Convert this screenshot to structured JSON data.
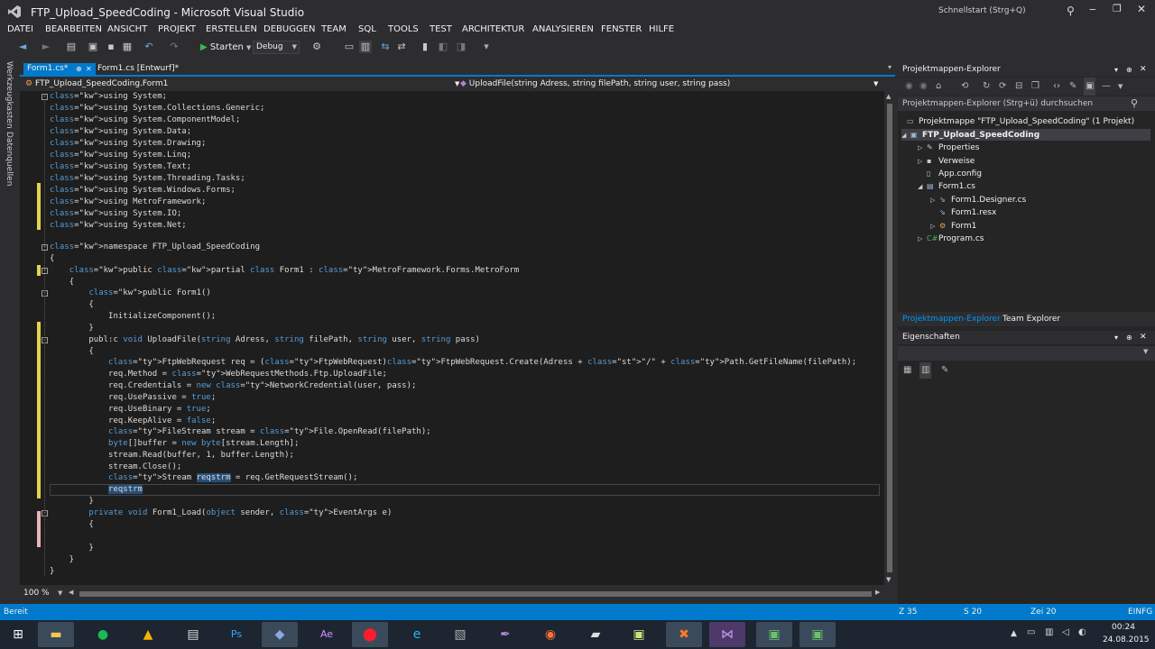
{
  "window": {
    "title": "FTP_Upload_SpeedCoding - Microsoft Visual Studio",
    "quick_launch": "Schnellstart (Strg+Q)"
  },
  "menu": [
    "DATEI",
    "BEARBEITEN",
    "ANSICHT",
    "PROJEKT",
    "ERSTELLEN",
    "DEBUGGEN",
    "TEAM",
    "SQL",
    "TOOLS",
    "TEST",
    "ARCHITEKTUR",
    "ANALYSIEREN",
    "FENSTER",
    "HILFE"
  ],
  "toolbar": {
    "start_label": "Starten",
    "config_value": "Debug"
  },
  "left_strip": {
    "toolbox": "Werkzeugkasten",
    "datasources": "Datenquellen"
  },
  "tabs": {
    "active": "Form1.cs*",
    "inactive": "Form1.cs [Entwurf]*"
  },
  "nav": {
    "class_combo": "FTP_Upload_SpeedCoding.Form1",
    "member_combo": "UploadFile(string Adress, string filePath, string user, string pass)"
  },
  "code": [
    "using System;",
    "using System.Collections.Generic;",
    "using System.ComponentModel;",
    "using System.Data;",
    "using System.Drawing;",
    "using System.Linq;",
    "using System.Text;",
    "using System.Threading.Tasks;",
    "using System.Windows.Forms;",
    "using MetroFramework;",
    "using System.IO;",
    "using System.Net;",
    "",
    "namespace FTP_Upload_SpeedCoding",
    "{",
    "    public partial class Form1 : MetroFramework.Forms.MetroForm",
    "    {",
    "        public Form1()",
    "        {",
    "            InitializeComponent();",
    "        }",
    "        publ:c void UploadFile(string Adress, string filePath, string user, string pass)",
    "        {",
    "            FtpWebRequest req = (FtpWebRequest)FtpWebRequest.Create(Adress + \"/\" + Path.GetFileName(filePath);",
    "            req.Method = WebRequestMethods.Ftp.UploadFile;",
    "            req.Credentials = new NetworkCredential(user, pass);",
    "            req.UsePassive = true;",
    "            req.UseBinary = true;",
    "            req.KeepAlive = false;",
    "            FileStream stream = File.OpenRead(filePath);",
    "            byte[]buffer = new byte[stream.Length];",
    "            stream.Read(buffer, 1, buffer.Length);",
    "            stream.Close();",
    "            Stream reqstrm = req.GetRequestStream();",
    "            reqstrm",
    "        }",
    "        private void Form1_Load(object sender, EventArgs e)",
    "        {",
    "",
    "        }",
    "    }",
    "}"
  ],
  "zoom": "100 %",
  "solution_explorer": {
    "title": "Projektmappen-Explorer",
    "search_placeholder": "Projektmappen-Explorer (Strg+ü) durchsuchen",
    "items": [
      {
        "label": "Projektmappe \"FTP_Upload_SpeedCoding\" (1 Projekt)",
        "icon": "solution-icon",
        "level": 0,
        "arrow": ""
      },
      {
        "label": "FTP_Upload_SpeedCoding",
        "icon": "csharp-project-icon",
        "level": 0,
        "arrow": "◢"
      },
      {
        "label": "Properties",
        "icon": "wrench-icon",
        "level": 1,
        "arrow": "▷"
      },
      {
        "label": "Verweise",
        "icon": "references-icon",
        "level": 1,
        "arrow": "▷"
      },
      {
        "label": "App.config",
        "icon": "config-file-icon",
        "level": 1,
        "arrow": ""
      },
      {
        "label": "Form1.cs",
        "icon": "form-icon",
        "level": 1,
        "arrow": "◢"
      },
      {
        "label": "Form1.Designer.cs",
        "icon": "csharp-file-icon",
        "level": 2,
        "arrow": "▷"
      },
      {
        "label": "Form1.resx",
        "icon": "resx-icon",
        "level": 2,
        "arrow": ""
      },
      {
        "label": "Form1",
        "icon": "class-icon",
        "level": 2,
        "arrow": "▷"
      },
      {
        "label": "Program.cs",
        "icon": "csharp-file-icon",
        "level": 1,
        "arrow": "▷"
      }
    ],
    "bottom_tabs": [
      "Projektmappen-Explorer",
      "Team Explorer"
    ]
  },
  "properties": {
    "title": "Eigenschaften"
  },
  "status": {
    "state": "Bereit",
    "line": "Z 35",
    "col": "S 20",
    "char": "Zei 20",
    "mode": "EINFG"
  },
  "taskbar": {
    "time": "00:24",
    "date": "24.08.2015"
  },
  "colors": {
    "accent": "#007acc",
    "keyword": "#569cd6",
    "type": "#4ec9b0",
    "string": "#d69d85",
    "selection": "#264f78",
    "change_marker": "#e6d34a"
  }
}
